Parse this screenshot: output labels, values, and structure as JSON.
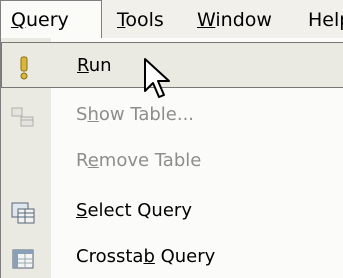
{
  "menubar": {
    "items": [
      {
        "pre": "",
        "key": "Q",
        "post": "uery"
      },
      {
        "pre": "",
        "key": "T",
        "post": "ools"
      },
      {
        "pre": "",
        "key": "W",
        "post": "indow"
      },
      {
        "pre": "",
        "key": "",
        "post": "Help"
      }
    ]
  },
  "dropdown": {
    "items": [
      {
        "pre": "",
        "key": "R",
        "post": "un",
        "icon": "exclamation-icon",
        "enabled": true,
        "highlighted": true
      },
      {
        "pre": "S",
        "key": "h",
        "post": "ow Table...",
        "icon": "show-table-icon",
        "enabled": false
      },
      {
        "pre": "R",
        "key": "e",
        "post": "move Table",
        "icon": "",
        "enabled": false
      },
      {
        "pre": "",
        "key": "S",
        "post": "elect Query",
        "icon": "select-query-icon",
        "enabled": true
      },
      {
        "pre": "Crossta",
        "key": "b",
        "post": " Query",
        "icon": "crosstab-query-icon",
        "enabled": true
      }
    ]
  },
  "colors": {
    "menubar_bg": "#f1f0ea",
    "menu_bg": "#fbfbf9",
    "gutter": "#ebeae2",
    "disabled_text": "#8d8d8d",
    "icon_yellow": "#d9b73a"
  }
}
